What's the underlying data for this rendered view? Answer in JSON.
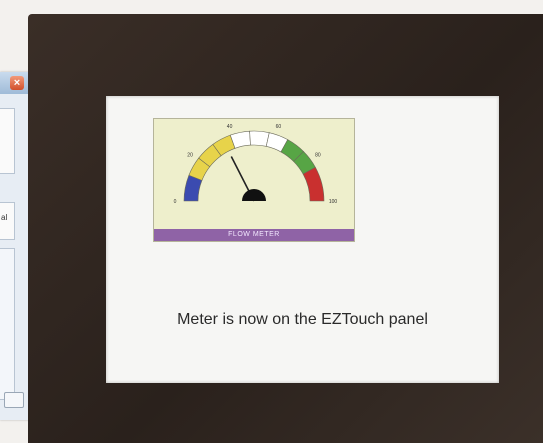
{
  "panel": {
    "status_text": "Meter is now on the EZTouch panel"
  },
  "meter": {
    "title": "FLOW METER",
    "scale_labels": [
      "0",
      "20",
      "40",
      "60",
      "80",
      "100"
    ],
    "needle_value": 35,
    "zone_colors": {
      "low": "#3b4bb0",
      "caution": "#e7d34a",
      "normal": "#ffffff",
      "good": "#57a545",
      "high": "#c9302f"
    }
  },
  "dialog": {
    "field_text": "al",
    "close_icon": "close-icon"
  }
}
